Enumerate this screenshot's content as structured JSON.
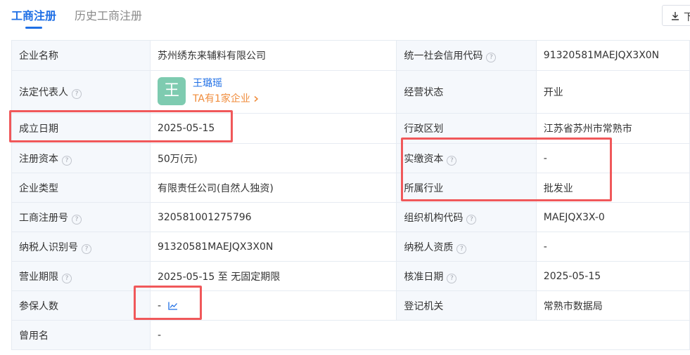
{
  "tabs": {
    "active": "工商注册",
    "inactive": "历史工商注册"
  },
  "toolbar": {
    "download_label": "下"
  },
  "rows": {
    "r1": {
      "l1": "企业名称",
      "v1": "苏州绣东来辅料有限公司",
      "l2": "统一社会信用代码",
      "v2": "91320581MAEJQX3X0N"
    },
    "r2": {
      "l1": "法定代表人",
      "l2": "经营状态",
      "v2": "开业"
    },
    "r3": {
      "l1": "成立日期",
      "v1": "2025-05-15",
      "l2": "行政区划",
      "v2": "江苏省苏州市常熟市"
    },
    "r4": {
      "l1": "注册资本",
      "v1": "50万(元)",
      "l2": "实缴资本",
      "v2": "-"
    },
    "r5": {
      "l1": "企业类型",
      "v1": "有限责任公司(自然人独资)",
      "l2": "所属行业",
      "v2": "批发业"
    },
    "r6": {
      "l1": "工商注册号",
      "v1": "320581001275796",
      "l2": "组织机构代码",
      "v2": "MAEJQX3X-0"
    },
    "r7": {
      "l1": "纳税人识别号",
      "v1": "91320581MAEJQX3X0N",
      "l2": "纳税人资质",
      "v2": "-"
    },
    "r8": {
      "l1": "营业期限",
      "v1": "2025-05-15 至 无固定期限",
      "l2": "核准日期",
      "v2": "2025-05-15"
    },
    "r9": {
      "l1": "参保人数",
      "v1": "-",
      "l2": "登记机关",
      "v2": "常熟市数据局"
    },
    "r10": {
      "l1": "曾用名",
      "v1": "-"
    }
  },
  "legal_rep": {
    "avatar_char": "王",
    "name": "王璐瑶",
    "link": "TA有1家企业"
  },
  "help_icon_glyph": "?",
  "colors": {
    "accent": "#1f6fe5",
    "link_orange": "#f08c3c",
    "avatar_bg": "#7ecbb0",
    "highlight": "#f0585a",
    "label_bg": "#f5f8fc",
    "border": "#e6ebf2"
  }
}
